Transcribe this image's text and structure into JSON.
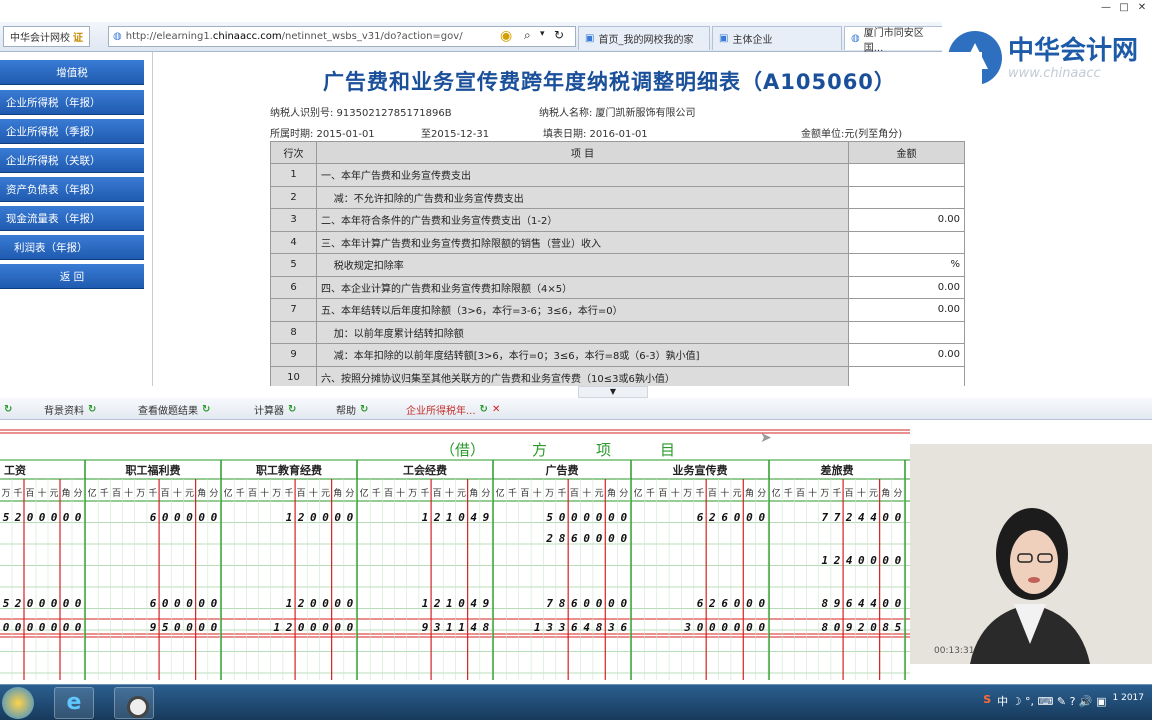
{
  "browser": {
    "site_badge": "中华会计网校",
    "cert_label": "证",
    "url_prefix": "http://elearning1.",
    "url_domain": "chinaacc.com",
    "url_rest": "/netinnet_wsbs_v31/do?action=gov/",
    "tabs": [
      "首页_我的网校我的家",
      "主体企业",
      "厦门市同安区国..."
    ],
    "window_controls": [
      "—",
      "□",
      "✕"
    ]
  },
  "logo": {
    "text": "中华会计网",
    "sub": "www.chinaacc"
  },
  "sidebar": {
    "items": [
      {
        "label": "增值税"
      },
      {
        "label": "企业所得税（年报）"
      },
      {
        "label": "企业所得税（季报）"
      },
      {
        "label": "企业所得税（关联）"
      },
      {
        "label": "资产负债表（年报）"
      },
      {
        "label": "现金流量表（年报）"
      },
      {
        "label": "利润表（年报）"
      },
      {
        "label": "返 回"
      }
    ]
  },
  "form": {
    "title": "广告费和业务宣传费跨年度纳税调整明细表（A105060）",
    "taxpayer_id": "纳税人识别号: 91350212785171896B",
    "taxpayer_name": "纳税人名称: 厦门凯新服饰有限公司",
    "period_from": "所属时期: 2015-01-01",
    "period_to": "至2015-12-31",
    "fill_date": "填表日期: 2016-01-01",
    "unit": "金额单位:元(列至角分)",
    "headers": [
      "行次",
      "项          目",
      "金额"
    ],
    "rows": [
      {
        "no": "1",
        "item": "一、本年广告费和业务宣传费支出",
        "amount": ""
      },
      {
        "no": "2",
        "item": "    减：不允许扣除的广告费和业务宣传费支出",
        "amount": ""
      },
      {
        "no": "3",
        "item": "二、本年符合条件的广告费和业务宣传费支出（1-2）",
        "amount": "0.00"
      },
      {
        "no": "4",
        "item": "三、本年计算广告费和业务宣传费扣除限额的销售（营业）收入",
        "amount": ""
      },
      {
        "no": "5",
        "item": "    税收规定扣除率",
        "amount": "%"
      },
      {
        "no": "6",
        "item": "四、本企业计算的广告费和业务宣传费扣除限额（4×5）",
        "amount": "0.00"
      },
      {
        "no": "7",
        "item": "五、本年结转以后年度扣除额（3>6，本行=3-6；3≤6，本行=0）",
        "amount": "0.00"
      },
      {
        "no": "8",
        "item": "    加：以前年度累计结转扣除额",
        "amount": ""
      },
      {
        "no": "9",
        "item": "    减：本年扣除的以前年度结转额[3>6，本行=0；3≤6，本行=8或（6-3）孰小值]",
        "amount": "0.00"
      },
      {
        "no": "10",
        "item": "六、按照分摊协议归集至其他关联方的广告费和业务宣传费（10≤3或6孰小值）",
        "amount": ""
      }
    ]
  },
  "toolbar": {
    "items": [
      "背景资料",
      "查看做题结果",
      "计算器",
      "帮助",
      "企业所得税年..."
    ]
  },
  "ledger": {
    "debit_label": "（借）",
    "header_chars": [
      "方",
      "项",
      "目"
    ],
    "columns": [
      "工资",
      "职工福利费",
      "职工教育经费",
      "工会经费",
      "广告费",
      "业务宣传费",
      "差旅费"
    ],
    "digit_units": "亿千百十万千百十元角分",
    "first_col_units": "万千百十元角分",
    "rows": [
      [
        "5200000",
        "600000",
        "120000",
        "121049",
        "5000000",
        "626000",
        "7724400"
      ],
      [
        "",
        "",
        "",
        "",
        "2860000",
        "",
        ""
      ],
      [
        "",
        "",
        "",
        "",
        "",
        "",
        "1240000"
      ],
      [
        "5200000",
        "600000",
        "120000",
        "121049",
        "7860000",
        "626000",
        "8964400"
      ],
      [
        "0000000",
        "950000",
        "1200000",
        "931148",
        "13364836",
        "3000000",
        "8092085"
      ]
    ]
  },
  "video": {
    "time": "00:13:31"
  },
  "taskbar": {
    "tray": "中 ☽ °, ⌨ ✎ ? 🔊 ▣",
    "clock": "1 2017"
  },
  "colors": {
    "sidebar_blue": "#2a6cc4",
    "title_blue": "#1a4f9a",
    "ledger_green": "#2a9a2a",
    "ledger_red": "#d42020"
  }
}
